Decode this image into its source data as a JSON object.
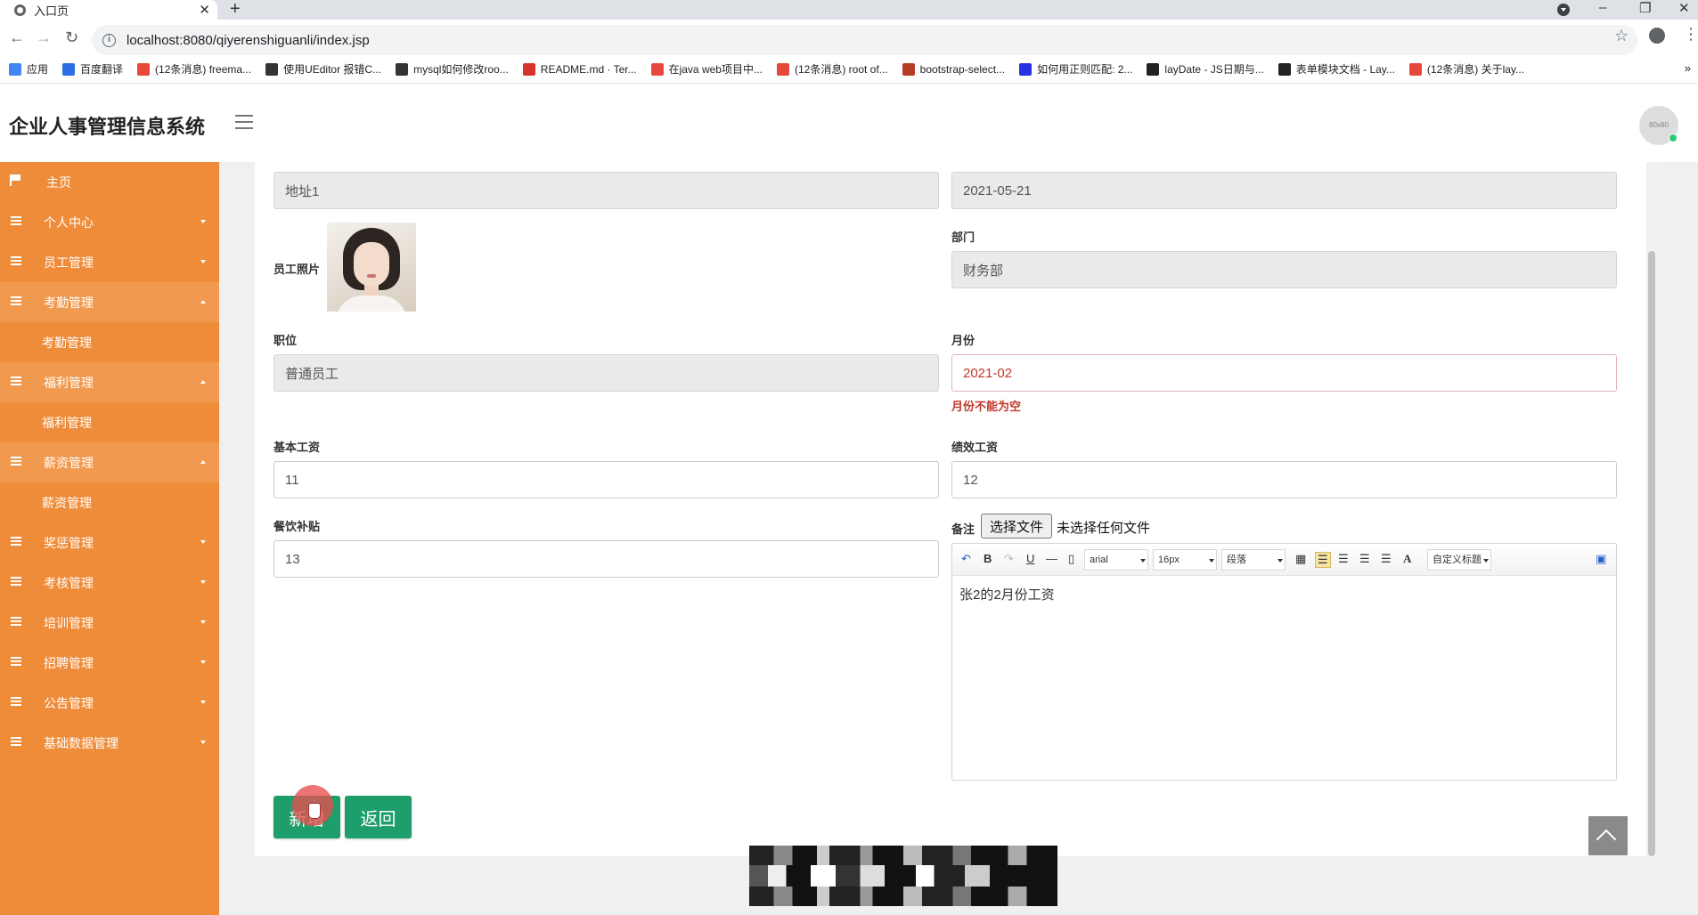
{
  "browser": {
    "tab_title": "入口页",
    "url": "localhost:8080/qiyerenshiguanli/index.jsp",
    "bookmarks": [
      {
        "label": "应用",
        "color": "#4285f4"
      },
      {
        "label": "百度翻译",
        "color": "#2b6de5"
      },
      {
        "label": "(12条消息) freema...",
        "color": "#e8473b"
      },
      {
        "label": "使用UEditor 报错C...",
        "color": "#333333"
      },
      {
        "label": "mysql如何修改roo...",
        "color": "#333333"
      },
      {
        "label": "README.md · Ter...",
        "color": "#d9342b"
      },
      {
        "label": "在java web项目中...",
        "color": "#e8473b"
      },
      {
        "label": "(12条消息) root of...",
        "color": "#e8473b"
      },
      {
        "label": "bootstrap-select...",
        "color": "#b43b26"
      },
      {
        "label": "如何用正则匹配: 2...",
        "color": "#2932e1"
      },
      {
        "label": "layDate - JS日期与...",
        "color": "#222222"
      },
      {
        "label": "表单模块文档 - Lay...",
        "color": "#222222"
      },
      {
        "label": "(12条消息) 关于lay...",
        "color": "#e8473b"
      }
    ]
  },
  "header": {
    "title": "企业人事管理信息系统",
    "avatar_text": "80x80"
  },
  "sidebar": {
    "items": [
      {
        "label": "主页"
      },
      {
        "label": "个人中心"
      },
      {
        "label": "员工管理"
      },
      {
        "label": "考勤管理",
        "sub": "考勤管理"
      },
      {
        "label": "福利管理",
        "sub": "福利管理"
      },
      {
        "label": "薪资管理",
        "sub": "薪资管理"
      },
      {
        "label": "奖惩管理"
      },
      {
        "label": "考核管理"
      },
      {
        "label": "培训管理"
      },
      {
        "label": "招聘管理"
      },
      {
        "label": "公告管理"
      },
      {
        "label": "基础数据管理"
      }
    ]
  },
  "form": {
    "address_value": "地址1",
    "date_value": "2021-05-21",
    "photo_label": "员工照片",
    "department_label": "部门",
    "department_value": "财务部",
    "position_label": "职位",
    "position_value": "普通员工",
    "month_label": "月份",
    "month_value": "2021-02",
    "month_error": "月份不能为空",
    "base_salary_label": "基本工资",
    "base_salary_value": "11",
    "perf_salary_label": "绩效工资",
    "perf_salary_value": "12",
    "meal_label": "餐饮补贴",
    "meal_value": "13",
    "remark_label": "备注",
    "file_button": "选择文件",
    "file_status": "未选择任何文件",
    "editor": {
      "font": "arial",
      "size": "16px",
      "paragraph": "段落",
      "custom_title": "自定义标题",
      "content": "张2的2月份工资"
    },
    "submit_label": "新增",
    "back_label": "返回"
  }
}
